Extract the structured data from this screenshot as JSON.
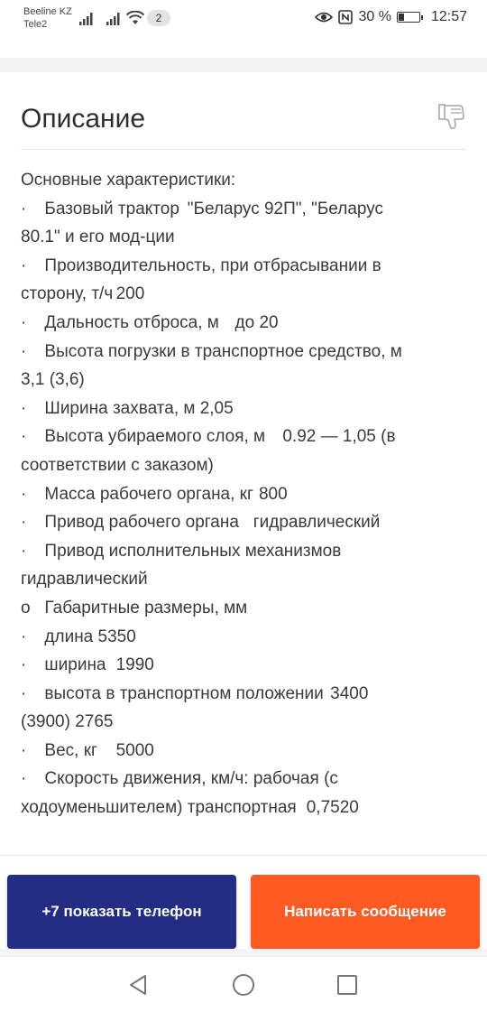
{
  "status_bar": {
    "carrier_1": "Beeline KZ",
    "carrier_2": "Tele2",
    "notification_count": "2",
    "battery_percent": "30 %",
    "battery_level": 0.3,
    "time": "12:57",
    "icons": [
      "signal-icon",
      "signal-icon",
      "wifi-icon",
      "eye-icon",
      "nfc-icon",
      "battery-icon"
    ]
  },
  "description": {
    "title": "Описание",
    "lines": [
      "Основные характеристики:",
      "·\tБазовый трактор\t\"Беларус 92П\", \"Беларус",
      "80.1\" и его мод-ции",
      "·\tПроизводительность, при отбрасывании в",
      "сторону, т/ч\t200",
      "·\tДальность отброса, м\tдо 20",
      "·\tВысота погрузки в транспортное средство, м",
      "3,1 (3,6)",
      "·\tШирина захвата, м 2,05",
      "·\tВысота убираемого слоя, м\t0.92 — 1,05 (в",
      "соответствии с заказом)",
      "·\tМасса рабочего органа, кг\t800",
      "·\tПривод рабочего органа   гидравлический",
      "·\tПривод исполнительных механизмов",
      "гидравлический",
      "o   Габаритные размеры, мм",
      "·\tдлина 5350",
      "·\tширина\t1990",
      "·\tвысота в транспортном положении\t3400",
      "(3900) 2765",
      "·\tВес, кг\t5000",
      "·\tСкорость движения, км/ч: рабочая (с",
      "ходоуменьшителем) транспортная\t0,7520"
    ]
  },
  "actions": {
    "phone_button": "+7 показать телефон",
    "message_button": "Написать сообщение"
  },
  "colors": {
    "phone_button_bg": "#232d84",
    "message_button_bg": "#ff5a22"
  }
}
